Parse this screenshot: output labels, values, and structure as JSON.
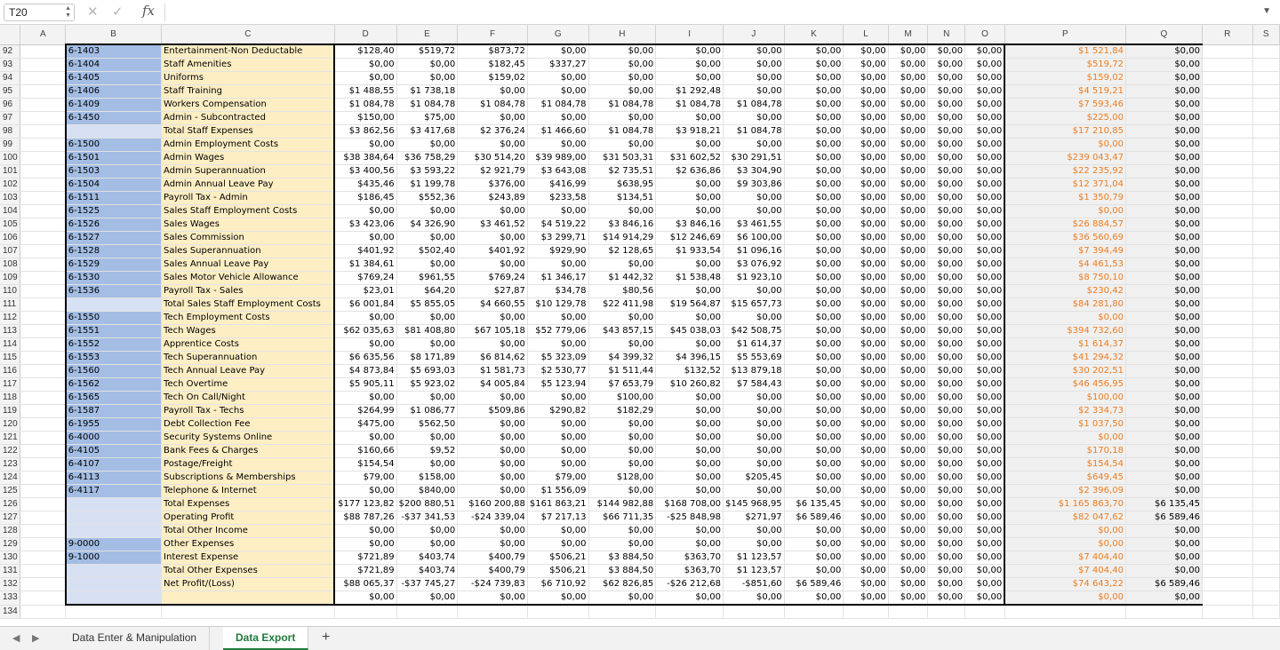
{
  "formula_bar": {
    "cell_ref": "T20",
    "formula": "",
    "fx_label": "fx"
  },
  "columns": [
    "A",
    "B",
    "C",
    "D",
    "E",
    "F",
    "G",
    "H",
    "I",
    "J",
    "K",
    "L",
    "M",
    "N",
    "O",
    "P",
    "Q",
    "R",
    "S"
  ],
  "rows": [
    {
      "n": "92",
      "b": "6-1403",
      "c": "Entertainment-Non Deductable",
      "d": "$128,40",
      "e": "$519,72",
      "f": "$873,72",
      "g": "$0,00",
      "h": "$0,00",
      "i": "$0,00",
      "j": "$0,00",
      "k": "$0,00",
      "l": "$0,00",
      "m": "$0,00",
      "nn": "$0,00",
      "o": "$0,00",
      "p": "$1 521,84",
      "q": "$0,00"
    },
    {
      "n": "93",
      "b": "6-1404",
      "c": "Staff Amenities",
      "d": "$0,00",
      "e": "$0,00",
      "f": "$182,45",
      "g": "$337,27",
      "h": "$0,00",
      "i": "$0,00",
      "j": "$0,00",
      "k": "$0,00",
      "l": "$0,00",
      "m": "$0,00",
      "nn": "$0,00",
      "o": "$0,00",
      "p": "$519,72",
      "q": "$0,00"
    },
    {
      "n": "94",
      "b": "6-1405",
      "c": "Uniforms",
      "d": "$0,00",
      "e": "$0,00",
      "f": "$159,02",
      "g": "$0,00",
      "h": "$0,00",
      "i": "$0,00",
      "j": "$0,00",
      "k": "$0,00",
      "l": "$0,00",
      "m": "$0,00",
      "nn": "$0,00",
      "o": "$0,00",
      "p": "$159,02",
      "q": "$0,00"
    },
    {
      "n": "95",
      "b": "6-1406",
      "c": "Staff Training",
      "d": "$1 488,55",
      "e": "$1 738,18",
      "f": "$0,00",
      "g": "$0,00",
      "h": "$0,00",
      "i": "$1 292,48",
      "j": "$0,00",
      "k": "$0,00",
      "l": "$0,00",
      "m": "$0,00",
      "nn": "$0,00",
      "o": "$0,00",
      "p": "$4 519,21",
      "q": "$0,00"
    },
    {
      "n": "96",
      "b": "6-1409",
      "c": "Workers Compensation",
      "d": "$1 084,78",
      "e": "$1 084,78",
      "f": "$1 084,78",
      "g": "$1 084,78",
      "h": "$1 084,78",
      "i": "$1 084,78",
      "j": "$1 084,78",
      "k": "$0,00",
      "l": "$0,00",
      "m": "$0,00",
      "nn": "$0,00",
      "o": "$0,00",
      "p": "$7 593,46",
      "q": "$0,00"
    },
    {
      "n": "97",
      "b": "6-1450",
      "c": "Admin - Subcontracted",
      "d": "$150,00",
      "e": "$75,00",
      "f": "$0,00",
      "g": "$0,00",
      "h": "$0,00",
      "i": "$0,00",
      "j": "$0,00",
      "k": "$0,00",
      "l": "$0,00",
      "m": "$0,00",
      "nn": "$0,00",
      "o": "$0,00",
      "p": "$225,00",
      "q": "$0,00"
    },
    {
      "n": "98",
      "b": "",
      "c": "Total Staff Expenses",
      "d": "$3 862,56",
      "e": "$3 417,68",
      "f": "$2 376,24",
      "g": "$1 466,60",
      "h": "$1 084,78",
      "i": "$3 918,21",
      "j": "$1 084,78",
      "k": "$0,00",
      "l": "$0,00",
      "m": "$0,00",
      "nn": "$0,00",
      "o": "$0,00",
      "p": "$17 210,85",
      "q": "$0,00"
    },
    {
      "n": "99",
      "b": "6-1500",
      "c": "Admin Employment Costs",
      "d": "$0,00",
      "e": "$0,00",
      "f": "$0,00",
      "g": "$0,00",
      "h": "$0,00",
      "i": "$0,00",
      "j": "$0,00",
      "k": "$0,00",
      "l": "$0,00",
      "m": "$0,00",
      "nn": "$0,00",
      "o": "$0,00",
      "p": "$0,00",
      "q": "$0,00"
    },
    {
      "n": "100",
      "b": "6-1501",
      "c": "Admin Wages",
      "d": "$38 384,64",
      "e": "$36 758,29",
      "f": "$30 514,20",
      "g": "$39 989,00",
      "h": "$31 503,31",
      "i": "$31 602,52",
      "j": "$30 291,51",
      "k": "$0,00",
      "l": "$0,00",
      "m": "$0,00",
      "nn": "$0,00",
      "o": "$0,00",
      "p": "$239 043,47",
      "q": "$0,00"
    },
    {
      "n": "101",
      "b": "6-1503",
      "c": "Admin Superannuation",
      "d": "$3 400,56",
      "e": "$3 593,22",
      "f": "$2 921,79",
      "g": "$3 643,08",
      "h": "$2 735,51",
      "i": "$2 636,86",
      "j": "$3 304,90",
      "k": "$0,00",
      "l": "$0,00",
      "m": "$0,00",
      "nn": "$0,00",
      "o": "$0,00",
      "p": "$22 235,92",
      "q": "$0,00"
    },
    {
      "n": "102",
      "b": "6-1504",
      "c": "Admin Annual Leave Pay",
      "d": "$435,46",
      "e": "$1 199,78",
      "f": "$376,00",
      "g": "$416,99",
      "h": "$638,95",
      "i": "$0,00",
      "j": "$9 303,86",
      "k": "$0,00",
      "l": "$0,00",
      "m": "$0,00",
      "nn": "$0,00",
      "o": "$0,00",
      "p": "$12 371,04",
      "q": "$0,00"
    },
    {
      "n": "103",
      "b": "6-1511",
      "c": "Payroll Tax - Admin",
      "d": "$186,45",
      "e": "$552,36",
      "f": "$243,89",
      "g": "$233,58",
      "h": "$134,51",
      "i": "$0,00",
      "j": "$0,00",
      "k": "$0,00",
      "l": "$0,00",
      "m": "$0,00",
      "nn": "$0,00",
      "o": "$0,00",
      "p": "$1 350,79",
      "q": "$0,00"
    },
    {
      "n": "104",
      "b": "6-1525",
      "c": "Sales Staff Employment Costs",
      "d": "$0,00",
      "e": "$0,00",
      "f": "$0,00",
      "g": "$0,00",
      "h": "$0,00",
      "i": "$0,00",
      "j": "$0,00",
      "k": "$0,00",
      "l": "$0,00",
      "m": "$0,00",
      "nn": "$0,00",
      "o": "$0,00",
      "p": "$0,00",
      "q": "$0,00"
    },
    {
      "n": "105",
      "b": "6-1526",
      "c": "Sales Wages",
      "d": "$3 423,06",
      "e": "$4 326,90",
      "f": "$3 461,52",
      "g": "$4 519,22",
      "h": "$3 846,16",
      "i": "$3 846,16",
      "j": "$3 461,55",
      "k": "$0,00",
      "l": "$0,00",
      "m": "$0,00",
      "nn": "$0,00",
      "o": "$0,00",
      "p": "$26 884,57",
      "q": "$0,00"
    },
    {
      "n": "106",
      "b": "6-1527",
      "c": "Sales Commission",
      "d": "$0,00",
      "e": "$0,00",
      "f": "$0,00",
      "g": "$3 299,71",
      "h": "$14 914,29",
      "i": "$12 246,69",
      "j": "$6 100,00",
      "k": "$0,00",
      "l": "$0,00",
      "m": "$0,00",
      "nn": "$0,00",
      "o": "$0,00",
      "p": "$36 560,69",
      "q": "$0,00"
    },
    {
      "n": "107",
      "b": "6-1528",
      "c": "Sales Superannuation",
      "d": "$401,92",
      "e": "$502,40",
      "f": "$401,92",
      "g": "$929,90",
      "h": "$2 128,65",
      "i": "$1 933,54",
      "j": "$1 096,16",
      "k": "$0,00",
      "l": "$0,00",
      "m": "$0,00",
      "nn": "$0,00",
      "o": "$0,00",
      "p": "$7 394,49",
      "q": "$0,00"
    },
    {
      "n": "108",
      "b": "6-1529",
      "c": "Sales Annual Leave Pay",
      "d": "$1 384,61",
      "e": "$0,00",
      "f": "$0,00",
      "g": "$0,00",
      "h": "$0,00",
      "i": "$0,00",
      "j": "$3 076,92",
      "k": "$0,00",
      "l": "$0,00",
      "m": "$0,00",
      "nn": "$0,00",
      "o": "$0,00",
      "p": "$4 461,53",
      "q": "$0,00"
    },
    {
      "n": "109",
      "b": "6-1530",
      "c": "Sales Motor Vehicle Allowance",
      "d": "$769,24",
      "e": "$961,55",
      "f": "$769,24",
      "g": "$1 346,17",
      "h": "$1 442,32",
      "i": "$1 538,48",
      "j": "$1 923,10",
      "k": "$0,00",
      "l": "$0,00",
      "m": "$0,00",
      "nn": "$0,00",
      "o": "$0,00",
      "p": "$8 750,10",
      "q": "$0,00"
    },
    {
      "n": "110",
      "b": "6-1536",
      "c": "Payroll Tax - Sales",
      "d": "$23,01",
      "e": "$64,20",
      "f": "$27,87",
      "g": "$34,78",
      "h": "$80,56",
      "i": "$0,00",
      "j": "$0,00",
      "k": "$0,00",
      "l": "$0,00",
      "m": "$0,00",
      "nn": "$0,00",
      "o": "$0,00",
      "p": "$230,42",
      "q": "$0,00"
    },
    {
      "n": "111",
      "b": "",
      "c": "Total Sales Staff Employment Costs",
      "d": "$6 001,84",
      "e": "$5 855,05",
      "f": "$4 660,55",
      "g": "$10 129,78",
      "h": "$22 411,98",
      "i": "$19 564,87",
      "j": "$15 657,73",
      "k": "$0,00",
      "l": "$0,00",
      "m": "$0,00",
      "nn": "$0,00",
      "o": "$0,00",
      "p": "$84 281,80",
      "q": "$0,00"
    },
    {
      "n": "112",
      "b": "6-1550",
      "c": "Tech Employment Costs",
      "d": "$0,00",
      "e": "$0,00",
      "f": "$0,00",
      "g": "$0,00",
      "h": "$0,00",
      "i": "$0,00",
      "j": "$0,00",
      "k": "$0,00",
      "l": "$0,00",
      "m": "$0,00",
      "nn": "$0,00",
      "o": "$0,00",
      "p": "$0,00",
      "q": "$0,00"
    },
    {
      "n": "113",
      "b": "6-1551",
      "c": "Tech Wages",
      "d": "$62 035,63",
      "e": "$81 408,80",
      "f": "$67 105,18",
      "g": "$52 779,06",
      "h": "$43 857,15",
      "i": "$45 038,03",
      "j": "$42 508,75",
      "k": "$0,00",
      "l": "$0,00",
      "m": "$0,00",
      "nn": "$0,00",
      "o": "$0,00",
      "p": "$394 732,60",
      "q": "$0,00"
    },
    {
      "n": "114",
      "b": "6-1552",
      "c": "Apprentice Costs",
      "d": "$0,00",
      "e": "$0,00",
      "f": "$0,00",
      "g": "$0,00",
      "h": "$0,00",
      "i": "$0,00",
      "j": "$1 614,37",
      "k": "$0,00",
      "l": "$0,00",
      "m": "$0,00",
      "nn": "$0,00",
      "o": "$0,00",
      "p": "$1 614,37",
      "q": "$0,00"
    },
    {
      "n": "115",
      "b": "6-1553",
      "c": "Tech Superannuation",
      "d": "$6 635,56",
      "e": "$8 171,89",
      "f": "$6 814,62",
      "g": "$5 323,09",
      "h": "$4 399,32",
      "i": "$4 396,15",
      "j": "$5 553,69",
      "k": "$0,00",
      "l": "$0,00",
      "m": "$0,00",
      "nn": "$0,00",
      "o": "$0,00",
      "p": "$41 294,32",
      "q": "$0,00"
    },
    {
      "n": "116",
      "b": "6-1560",
      "c": "Tech Annual Leave Pay",
      "d": "$4 873,84",
      "e": "$5 693,03",
      "f": "$1 581,73",
      "g": "$2 530,77",
      "h": "$1 511,44",
      "i": "$132,52",
      "j": "$13 879,18",
      "k": "$0,00",
      "l": "$0,00",
      "m": "$0,00",
      "nn": "$0,00",
      "o": "$0,00",
      "p": "$30 202,51",
      "q": "$0,00"
    },
    {
      "n": "117",
      "b": "6-1562",
      "c": "Tech Overtime",
      "d": "$5 905,11",
      "e": "$5 923,02",
      "f": "$4 005,84",
      "g": "$5 123,94",
      "h": "$7 653,79",
      "i": "$10 260,82",
      "j": "$7 584,43",
      "k": "$0,00",
      "l": "$0,00",
      "m": "$0,00",
      "nn": "$0,00",
      "o": "$0,00",
      "p": "$46 456,95",
      "q": "$0,00"
    },
    {
      "n": "118",
      "b": "6-1565",
      "c": "Tech On Call/Night",
      "d": "$0,00",
      "e": "$0,00",
      "f": "$0,00",
      "g": "$0,00",
      "h": "$100,00",
      "i": "$0,00",
      "j": "$0,00",
      "k": "$0,00",
      "l": "$0,00",
      "m": "$0,00",
      "nn": "$0,00",
      "o": "$0,00",
      "p": "$100,00",
      "q": "$0,00"
    },
    {
      "n": "119",
      "b": "6-1587",
      "c": "Payroll Tax - Techs",
      "d": "$264,99",
      "e": "$1 086,77",
      "f": "$509,86",
      "g": "$290,82",
      "h": "$182,29",
      "i": "$0,00",
      "j": "$0,00",
      "k": "$0,00",
      "l": "$0,00",
      "m": "$0,00",
      "nn": "$0,00",
      "o": "$0,00",
      "p": "$2 334,73",
      "q": "$0,00"
    },
    {
      "n": "120",
      "b": "6-1955",
      "c": "Debt Collection Fee",
      "d": "$475,00",
      "e": "$562,50",
      "f": "$0,00",
      "g": "$0,00",
      "h": "$0,00",
      "i": "$0,00",
      "j": "$0,00",
      "k": "$0,00",
      "l": "$0,00",
      "m": "$0,00",
      "nn": "$0,00",
      "o": "$0,00",
      "p": "$1 037,50",
      "q": "$0,00"
    },
    {
      "n": "121",
      "b": "6-4000",
      "c": "Security Systems Online",
      "d": "$0,00",
      "e": "$0,00",
      "f": "$0,00",
      "g": "$0,00",
      "h": "$0,00",
      "i": "$0,00",
      "j": "$0,00",
      "k": "$0,00",
      "l": "$0,00",
      "m": "$0,00",
      "nn": "$0,00",
      "o": "$0,00",
      "p": "$0,00",
      "q": "$0,00"
    },
    {
      "n": "122",
      "b": "6-4105",
      "c": "Bank Fees & Charges",
      "d": "$160,66",
      "e": "$9,52",
      "f": "$0,00",
      "g": "$0,00",
      "h": "$0,00",
      "i": "$0,00",
      "j": "$0,00",
      "k": "$0,00",
      "l": "$0,00",
      "m": "$0,00",
      "nn": "$0,00",
      "o": "$0,00",
      "p": "$170,18",
      "q": "$0,00"
    },
    {
      "n": "123",
      "b": "6-4107",
      "c": "Postage/Freight",
      "d": "$154,54",
      "e": "$0,00",
      "f": "$0,00",
      "g": "$0,00",
      "h": "$0,00",
      "i": "$0,00",
      "j": "$0,00",
      "k": "$0,00",
      "l": "$0,00",
      "m": "$0,00",
      "nn": "$0,00",
      "o": "$0,00",
      "p": "$154,54",
      "q": "$0,00"
    },
    {
      "n": "124",
      "b": "6-4113",
      "c": "Subscriptions & Memberships",
      "d": "$79,00",
      "e": "$158,00",
      "f": "$0,00",
      "g": "$79,00",
      "h": "$128,00",
      "i": "$0,00",
      "j": "$205,45",
      "k": "$0,00",
      "l": "$0,00",
      "m": "$0,00",
      "nn": "$0,00",
      "o": "$0,00",
      "p": "$649,45",
      "q": "$0,00"
    },
    {
      "n": "125",
      "b": "6-4117",
      "c": "Telephone & Internet",
      "d": "$0,00",
      "e": "$840,00",
      "f": "$0,00",
      "g": "$1 556,09",
      "h": "$0,00",
      "i": "$0,00",
      "j": "$0,00",
      "k": "$0,00",
      "l": "$0,00",
      "m": "$0,00",
      "nn": "$0,00",
      "o": "$0,00",
      "p": "$2 396,09",
      "q": "$0,00"
    },
    {
      "n": "126",
      "b": "",
      "c": "Total Expenses",
      "d": "$177 123,82",
      "e": "$200 880,51",
      "f": "$160 200,88",
      "g": "$161 863,21",
      "h": "$144 982,88",
      "i": "$168 708,00",
      "j": "$145 968,95",
      "k": "$6 135,45",
      "l": "$0,00",
      "m": "$0,00",
      "nn": "$0,00",
      "o": "$0,00",
      "p": "$1 165 863,70",
      "q": "$6 135,45"
    },
    {
      "n": "127",
      "b": "",
      "c": "Operating Profit",
      "d": "$88 787,26",
      "e": "-$37 341,53",
      "f": "-$24 339,04",
      "g": "$7 217,13",
      "h": "$66 711,35",
      "i": "-$25 848,98",
      "j": "$271,97",
      "k": "$6 589,46",
      "l": "$0,00",
      "m": "$0,00",
      "nn": "$0,00",
      "o": "$0,00",
      "p": "$82 047,62",
      "q": "$6 589,46"
    },
    {
      "n": "128",
      "b": "",
      "c": "Total Other Income",
      "d": "$0,00",
      "e": "$0,00",
      "f": "$0,00",
      "g": "$0,00",
      "h": "$0,00",
      "i": "$0,00",
      "j": "$0,00",
      "k": "$0,00",
      "l": "$0,00",
      "m": "$0,00",
      "nn": "$0,00",
      "o": "$0,00",
      "p": "$0,00",
      "q": "$0,00"
    },
    {
      "n": "129",
      "b": "9-0000",
      "c": "Other Expenses",
      "d": "$0,00",
      "e": "$0,00",
      "f": "$0,00",
      "g": "$0,00",
      "h": "$0,00",
      "i": "$0,00",
      "j": "$0,00",
      "k": "$0,00",
      "l": "$0,00",
      "m": "$0,00",
      "nn": "$0,00",
      "o": "$0,00",
      "p": "$0,00",
      "q": "$0,00"
    },
    {
      "n": "130",
      "b": "9-1000",
      "c": "Interest Expense",
      "d": "$721,89",
      "e": "$403,74",
      "f": "$400,79",
      "g": "$506,21",
      "h": "$3 884,50",
      "i": "$363,70",
      "j": "$1 123,57",
      "k": "$0,00",
      "l": "$0,00",
      "m": "$0,00",
      "nn": "$0,00",
      "o": "$0,00",
      "p": "$7 404,40",
      "q": "$0,00"
    },
    {
      "n": "131",
      "b": "",
      "c": "Total Other Expenses",
      "d": "$721,89",
      "e": "$403,74",
      "f": "$400,79",
      "g": "$506,21",
      "h": "$3 884,50",
      "i": "$363,70",
      "j": "$1 123,57",
      "k": "$0,00",
      "l": "$0,00",
      "m": "$0,00",
      "nn": "$0,00",
      "o": "$0,00",
      "p": "$7 404,40",
      "q": "$0,00"
    },
    {
      "n": "132",
      "b": "",
      "c": "Net Profit/(Loss)",
      "d": "$88 065,37",
      "e": "-$37 745,27",
      "f": "-$24 739,83",
      "g": "$6 710,92",
      "h": "$62 826,85",
      "i": "-$26 212,68",
      "j": "-$851,60",
      "k": "$6 589,46",
      "l": "$0,00",
      "m": "$0,00",
      "nn": "$0,00",
      "o": "$0,00",
      "p": "$74 643,22",
      "q": "$6 589,46"
    },
    {
      "n": "133",
      "b": "",
      "c": "",
      "d": "$0,00",
      "e": "$0,00",
      "f": "$0,00",
      "g": "$0,00",
      "h": "$0,00",
      "i": "$0,00",
      "j": "$0,00",
      "k": "$0,00",
      "l": "$0,00",
      "m": "$0,00",
      "nn": "$0,00",
      "o": "$0,00",
      "p": "$0,00",
      "q": "$0,00"
    },
    {
      "n": "134",
      "b": "",
      "c": "",
      "d": "",
      "e": "",
      "f": "",
      "g": "",
      "h": "",
      "i": "",
      "j": "",
      "k": "",
      "l": "",
      "m": "",
      "nn": "",
      "o": "",
      "p": "",
      "q": ""
    }
  ],
  "sheet_tabs": [
    {
      "label": "Data Enter & Manipulation",
      "active": false
    },
    {
      "label": "Data Export",
      "active": true
    }
  ],
  "colors": {
    "accent_green": "#1e7a3b",
    "orange_total": "#ec7c1e",
    "col_b_fill": "#d7e1f3",
    "col_c_fill": "#fdeec4"
  },
  "icons": [
    "cancel-icon",
    "confirm-icon",
    "fx-icon",
    "dropdown-icon",
    "prev-sheet-icon",
    "next-sheet-icon",
    "add-sheet-icon"
  ]
}
